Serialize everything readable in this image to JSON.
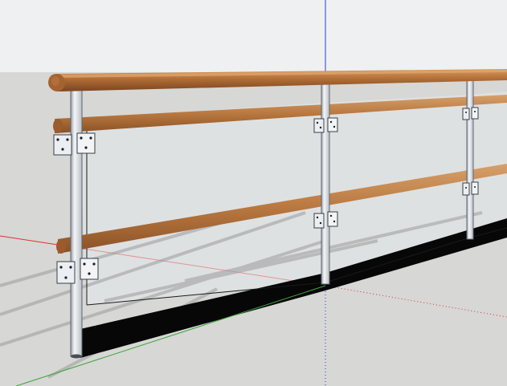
{
  "viewport": {
    "label": "",
    "colors": {
      "sky": "#eef0f2",
      "ground": "#d7d7d5",
      "axis_red": "#e03030",
      "axis_green": "#3aa53a",
      "axis_blue": "#2a3ad8",
      "wood_light": "#c98a4e",
      "wood_dark": "#8f5326",
      "steel": "#dde1e6",
      "steel_edge": "#5e6670",
      "glass": "#e4e9ec",
      "shadow": "#070707"
    },
    "objects": [
      "handrail",
      "wooden-rails",
      "steel-posts",
      "mounting-brackets",
      "glass-panels"
    ]
  }
}
